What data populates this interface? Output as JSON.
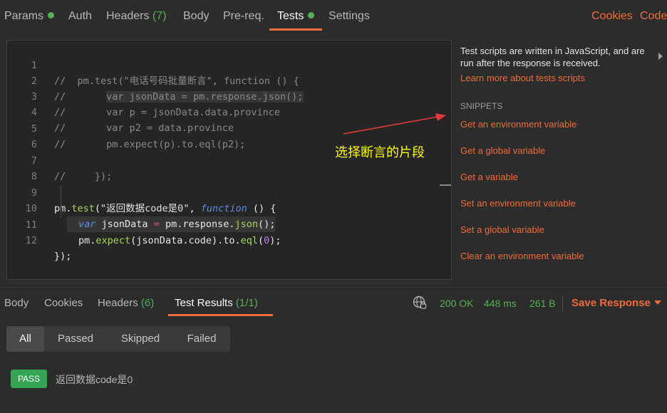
{
  "request_tabs": {
    "params": "Params",
    "auth": "Auth",
    "headers": "Headers",
    "headers_count": "(7)",
    "body": "Body",
    "prereq": "Pre-req.",
    "tests": "Tests",
    "settings": "Settings",
    "cookies": "Cookies",
    "code": "Code"
  },
  "editor": {
    "line_numbers": [
      "1",
      "2",
      "3",
      "4",
      "5",
      "6",
      "7",
      "8",
      "9",
      "10",
      "11",
      "12"
    ],
    "line1": "//  pm.test(\"电话号码批量断言\", function () {",
    "line2_a": "//       ",
    "line2_b": "var jsonData = pm.response.json();",
    "line3": "//       var p = jsonData.data.province",
    "line4": "//       var p2 = data.province",
    "line5": "//       pm.expect(p).to.eql(p2);",
    "line7": "//     });",
    "line9": {
      "pm": "pm.",
      "test": "test",
      "open": "(",
      "str": "\"返回数据code是0\"",
      "comma": ", ",
      "kw": "function",
      "rest": " () {"
    },
    "line10": {
      "kw": "var",
      "name": " jsonData ",
      "eq": "=",
      "pm": " pm.response.",
      "fn": "json",
      "end": "();"
    },
    "line11": {
      "pm": "pm.",
      "fn1": "expect",
      "mid": "(jsonData.code).to.",
      "fn2": "eql",
      "open": "(",
      "num": "0",
      "end": ");"
    },
    "line12": "});"
  },
  "side_panel": {
    "description": "Test scripts are written in JavaScript, and are run after the response is received.",
    "learn_more": "Learn more about tests scripts",
    "snippets_heading": "SNIPPETS",
    "snippets": [
      "Get an environment variable",
      "Get a global variable",
      "Get a variable",
      "Set an environment variable",
      "Set a global variable",
      "Clear an environment variable"
    ]
  },
  "annotation": {
    "text": "选择断言的片段",
    "color": "#ffff00"
  },
  "response_tabs": {
    "body": "Body",
    "cookies": "Cookies",
    "headers": "Headers",
    "headers_count": "(6)",
    "test_results": "Test Results",
    "test_results_count": "(1/1)"
  },
  "response_status": {
    "status": "200 OK",
    "time": "448 ms",
    "size": "261 B",
    "save_response": "Save Response"
  },
  "filters": {
    "all": "All",
    "passed": "Passed",
    "skipped": "Skipped",
    "failed": "Failed"
  },
  "results": [
    {
      "badge": "PASS",
      "name": "返回数据code是0"
    }
  ],
  "colors": {
    "accent": "#f26b3a",
    "success": "#55b054",
    "background": "#2c2c2c"
  }
}
